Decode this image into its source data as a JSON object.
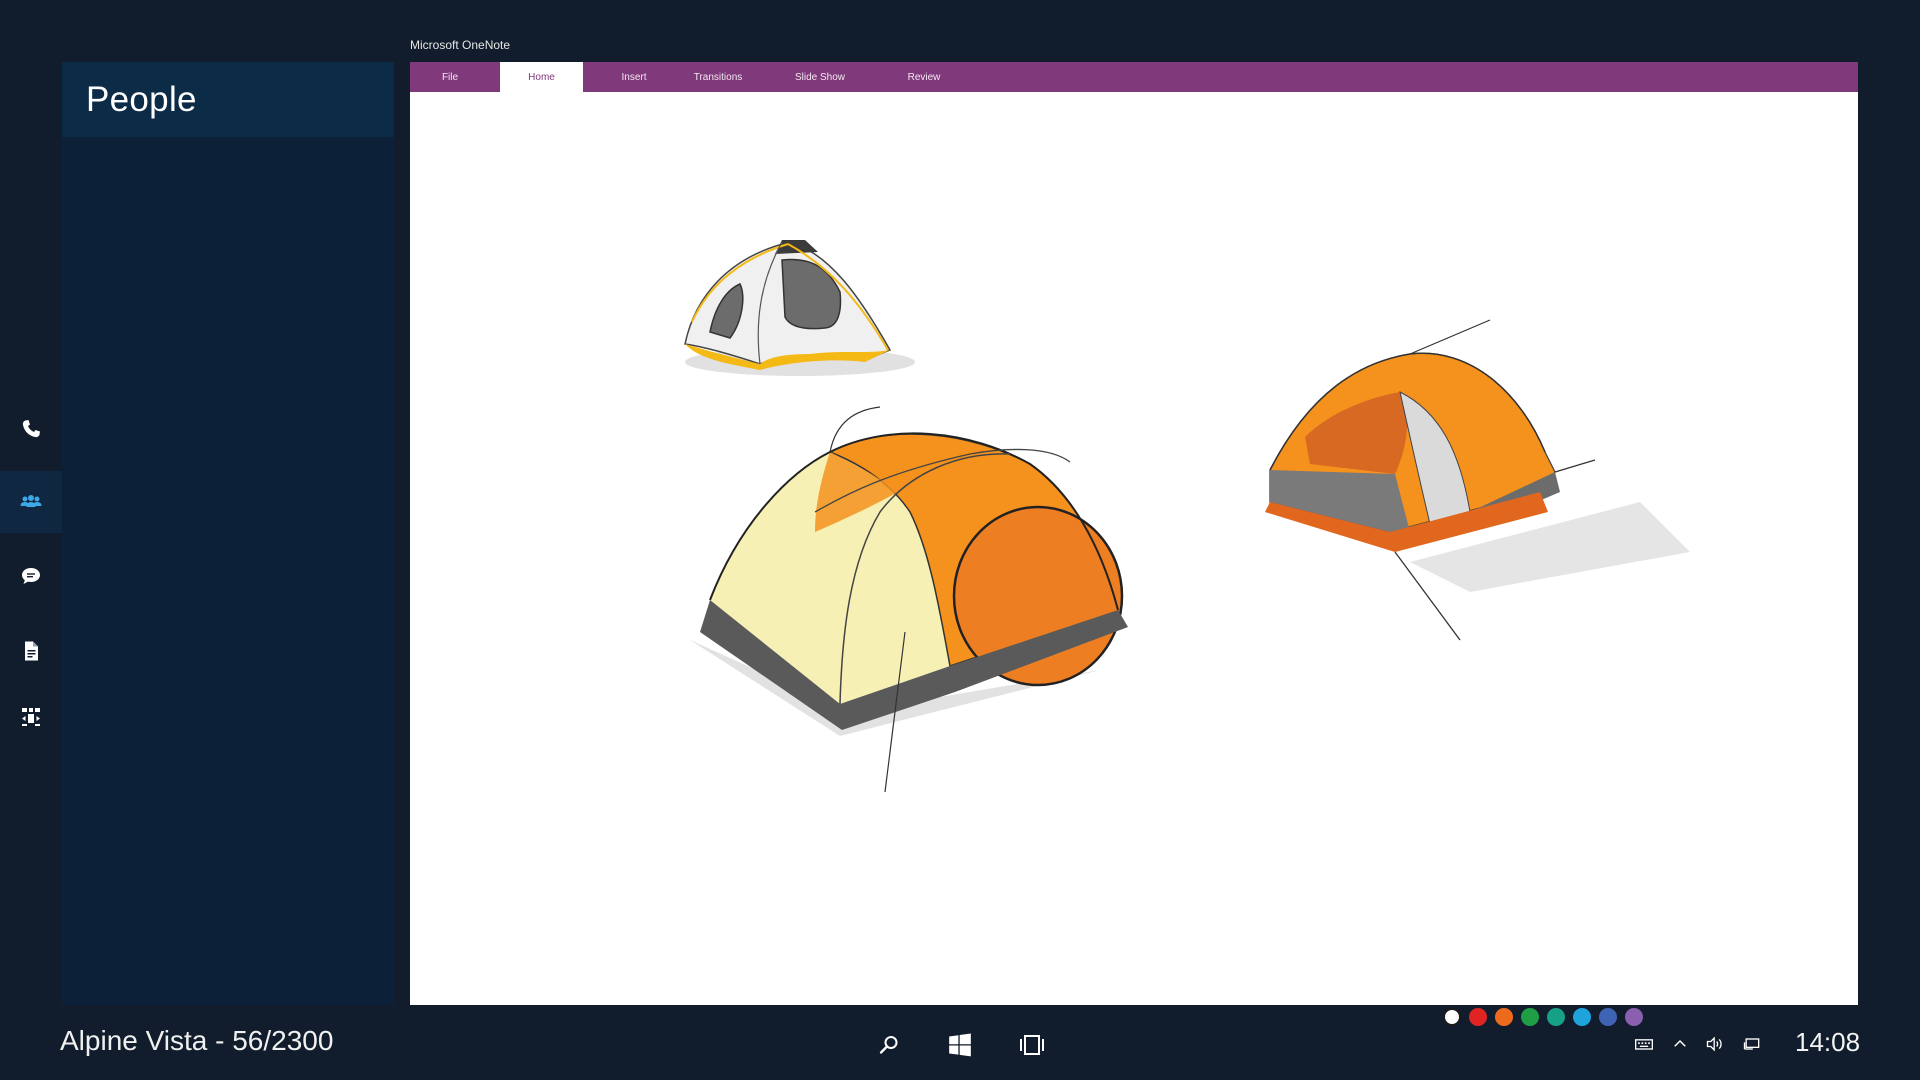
{
  "app": {
    "title": "Microsoft OneNote"
  },
  "side_panel": {
    "title": "People"
  },
  "rail": {
    "items": [
      {
        "icon": "phone-icon",
        "active": false
      },
      {
        "icon": "people-icon",
        "active": true
      },
      {
        "icon": "chat-icon",
        "active": false
      },
      {
        "icon": "document-icon",
        "active": false
      },
      {
        "icon": "share-screen-icon",
        "active": false
      }
    ]
  },
  "ribbon": {
    "tabs": [
      {
        "label": "File",
        "active": false
      },
      {
        "label": "Home",
        "active": true
      },
      {
        "label": "Insert",
        "active": false
      },
      {
        "label": "Transitions",
        "active": false
      },
      {
        "label": "Slide Show",
        "active": false
      },
      {
        "label": "Review",
        "active": false
      }
    ]
  },
  "palette": {
    "colors": [
      "#ffffff",
      "#e02424",
      "#ee6a1c",
      "#1f9e46",
      "#16a085",
      "#1fa3dd",
      "#3f64b5",
      "#8a5fb0"
    ]
  },
  "taskbar": {
    "room_label": "Alpine Vista - 56/2300",
    "clock": "14:08",
    "center_icons": [
      "search-icon",
      "windows-start-icon",
      "task-view-icon"
    ],
    "tray_icons": [
      "keyboard-icon",
      "chevron-up-icon",
      "volume-icon",
      "display-icon"
    ]
  },
  "colors": {
    "ribbon": "#80397b",
    "side_panel": "#0c2138",
    "side_header": "#0b2b47",
    "background": "#111d2c",
    "accent": "#3ea7e6"
  }
}
